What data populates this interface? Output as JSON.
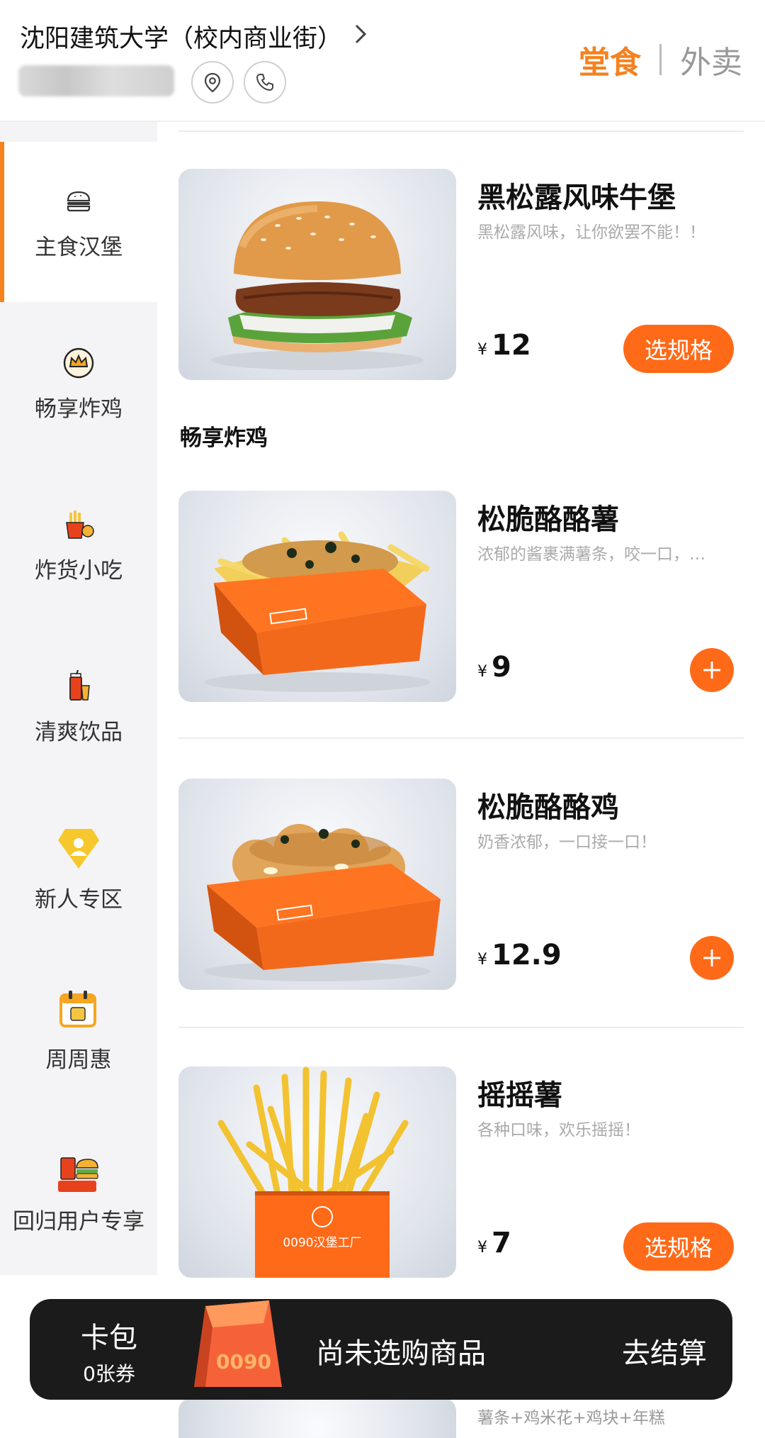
{
  "header": {
    "store_name": "沈阳建筑大学（校内商业街）",
    "mode_dine_in": "堂食",
    "mode_delivery": "外卖"
  },
  "sidebar": {
    "items": [
      {
        "label": "主食汉堡",
        "icon": "burger-icon",
        "active": true
      },
      {
        "label": "畅享炸鸡",
        "icon": "crown-icon",
        "active": false
      },
      {
        "label": "炸货小吃",
        "icon": "fries-icon",
        "active": false
      },
      {
        "label": "清爽饮品",
        "icon": "drink-icon",
        "active": false
      },
      {
        "label": "新人专区",
        "icon": "new-user-badge-icon",
        "active": false
      },
      {
        "label": "周周惠",
        "icon": "calendar-discount-icon",
        "active": false
      },
      {
        "label": "回归用户专享",
        "icon": "returning-user-icon",
        "active": false
      }
    ]
  },
  "sections": {
    "fried_chicken_title": "畅享炸鸡"
  },
  "products": [
    {
      "name": "黑松露风味牛堡",
      "desc": "黑松露风味，让你欲罢不能！！",
      "currency": "¥",
      "price": "12",
      "action": "选规格"
    },
    {
      "name": "松脆酪酪薯",
      "desc": "浓郁的酱裹满薯条，咬一口，…",
      "currency": "¥",
      "price": "9",
      "action": "add"
    },
    {
      "name": "松脆酪酪鸡",
      "desc": "奶香浓郁，一口接一口！",
      "currency": "¥",
      "price": "12.9",
      "action": "add"
    },
    {
      "name": "摇摇薯",
      "desc": "各种口味，欢乐摇摇！",
      "currency": "¥",
      "price": "7",
      "action": "选规格"
    }
  ],
  "images": {
    "fries_box_brand": "0090汉堡工厂",
    "bag_brand": "0090"
  },
  "peek": {
    "desc": "薯条+鸡米花+鸡块+年糕"
  },
  "cart": {
    "card_pack_title": "卡包",
    "card_pack_count": "0张券",
    "status": "尚未选购商品",
    "checkout": "去结算"
  },
  "colors": {
    "accent": "#f5821f",
    "button": "#ff6a18",
    "cart_bg": "#1b1b1b"
  }
}
